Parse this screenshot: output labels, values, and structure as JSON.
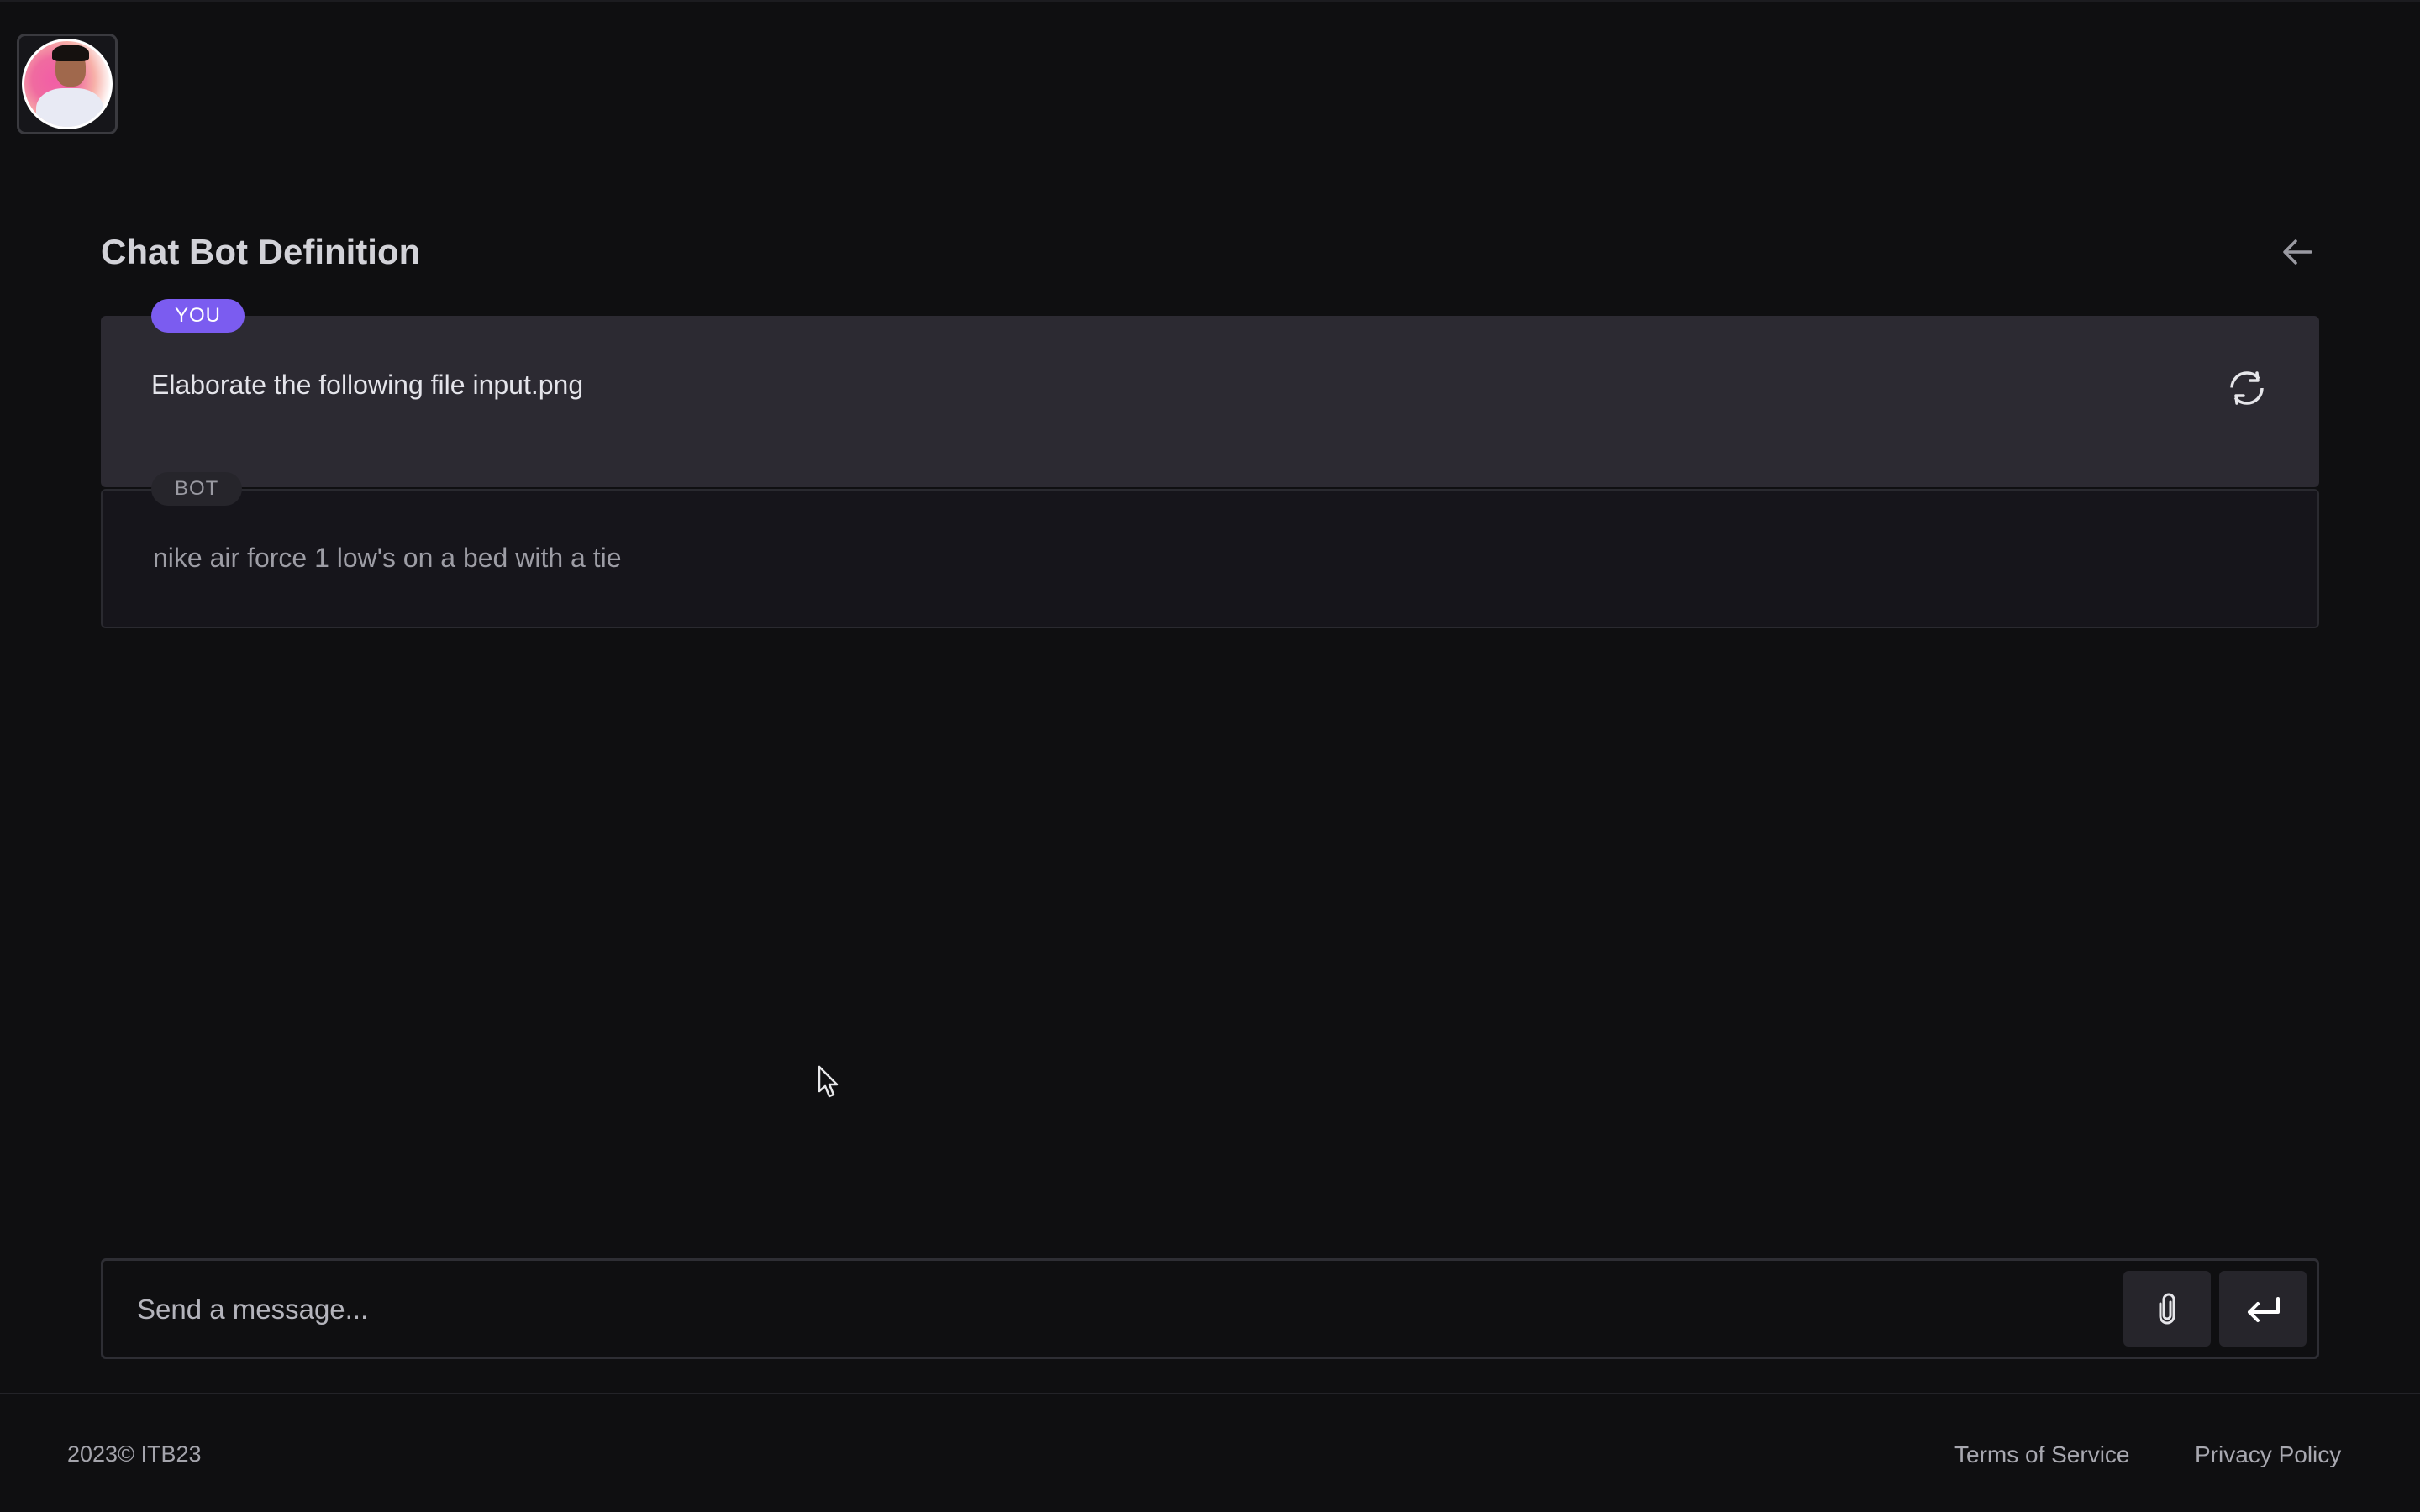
{
  "page": {
    "title": "Chat Bot Definition"
  },
  "header": {
    "avatar_icon": "user-avatar-photo",
    "back_icon": "arrow-left-icon"
  },
  "conversation": {
    "user_message": {
      "role_label": "YOU",
      "text": "Elaborate the following file input.png",
      "action_icon": "refresh-icon"
    },
    "bot_message": {
      "role_label": "BOT",
      "text": "nike air force 1 low's on a bed with a tie"
    }
  },
  "composer": {
    "placeholder": "Send a message...",
    "value": "",
    "attach_icon": "paperclip-icon",
    "send_icon": "enter-return-icon"
  },
  "footer": {
    "copyright": "2023© ITB23",
    "links": [
      {
        "label": "Terms of Service"
      },
      {
        "label": "Privacy Policy"
      }
    ]
  },
  "colors": {
    "background": "#0f0f11",
    "user_bubble": "#2c2a32",
    "bot_bubble": "#16151b",
    "accent": "#7b5cf0"
  }
}
